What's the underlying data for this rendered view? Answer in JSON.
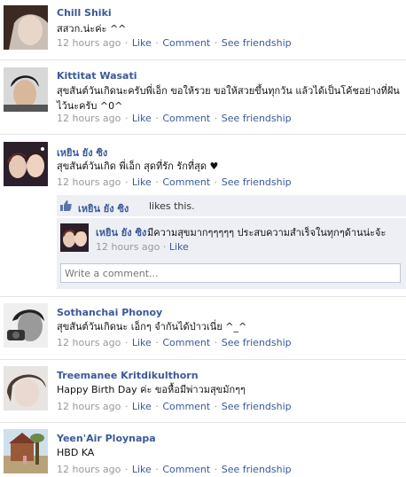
{
  "actions": {
    "like": "Like",
    "comment": "Comment",
    "friendship": "See friendship",
    "dot": "·"
  },
  "posts": [
    {
      "name": "Chill Shiki",
      "message": "สสวก.น่ะค่ะ ^^",
      "time": "12 hours ago"
    },
    {
      "name": "Kittitat Wasati",
      "message": "สุขสันต์วันเกิดนะครับพี่เอ็ก ขอให้รวย ขอให้สวยขึ้นทุกวัน แล้วได้เป็นโค้ชอย่างที่ฝันไว้นะครับ ^0^",
      "time": "12 hours ago"
    },
    {
      "name": "เหยิน ยัง ซิง",
      "message": "สุขสันต์วันเกิด พี่เอ็ก สุดที่รัก รักที่สุด ♥",
      "time": "12 hours ago"
    },
    {
      "name": "Sothanchai Phonoy",
      "message": "สุขสันต์วันเกิดนะ เอ็กๆ จำกันได้ป่าวเนี่ย ^_^",
      "time": "12 hours ago"
    },
    {
      "name": "Treemanee Kritdikulthorn",
      "message": "Happy Birth Day ค่ะ ขอหื้อมีพ่าวมสุขมักๆๆ",
      "time": "12 hours ago"
    },
    {
      "name": "Yeen'Air Ploynapa",
      "message": "HBD KA",
      "time": "12 hours ago"
    }
  ],
  "likes": {
    "name": "เหยิน ยัง ซิง",
    "text": "likes this."
  },
  "comment": {
    "name": "เหยิน ยัง ซิง",
    "text": "มีความสุขมากๆๆๆๆๆ ประสบความสำเร็จในทุกๆด้านน่ะจ้ะ",
    "time": "12 hours ago",
    "like": "Like"
  },
  "write_comment": {
    "placeholder": "Write a comment..."
  },
  "colors": {
    "link": "#3b5998",
    "meta": "#999999",
    "panel": "#edeff4"
  }
}
